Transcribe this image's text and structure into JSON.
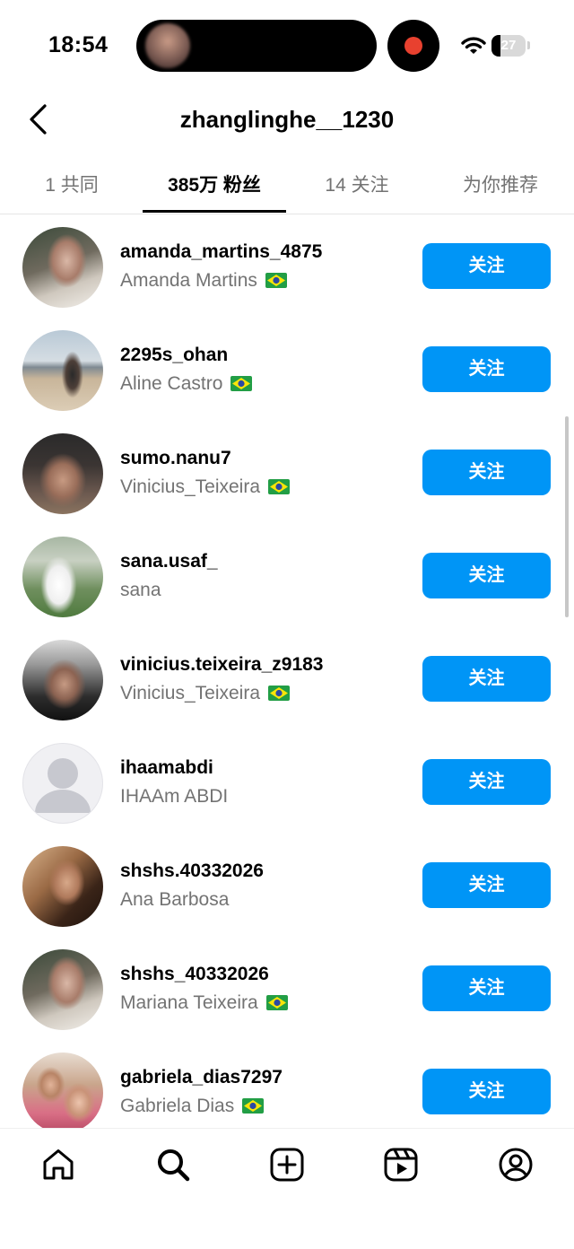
{
  "status_bar": {
    "time": "18:54",
    "battery": "27",
    "record_color": "#e8412f"
  },
  "header": {
    "title": "zhanglinghe__1230",
    "back_icon": "chevron-left-icon"
  },
  "tabs": [
    {
      "label": "1 共同",
      "active": false
    },
    {
      "label": "385万 粉丝",
      "active": true
    },
    {
      "label": "14 关注",
      "active": false
    },
    {
      "label": "为你推荐",
      "active": false
    }
  ],
  "follow_label": "关注",
  "accent_color": "#0095f6",
  "followers": [
    {
      "username": "amanda_martins_4875",
      "name": "Amanda Martins",
      "flag": "brazil-flag-icon"
    },
    {
      "username": "2295s_ohan",
      "name": "Aline Castro",
      "flag": "brazil-flag-icon"
    },
    {
      "username": "sumo.nanu7",
      "name": "Vinicius_Teixeira",
      "flag": "brazil-flag-icon"
    },
    {
      "username": "sana.usaf_",
      "name": "sana",
      "flag": null
    },
    {
      "username": "vinicius.teixeira_z9183",
      "name": "Vinicius_Teixeira",
      "flag": "brazil-flag-icon"
    },
    {
      "username": "ihaamabdi",
      "name": "IHAAm ABDI",
      "flag": null
    },
    {
      "username": "shshs.40332026",
      "name": "Ana Barbosa",
      "flag": null
    },
    {
      "username": "shshs_40332026",
      "name": "Mariana Teixeira",
      "flag": "brazil-flag-icon"
    },
    {
      "username": "gabriela_dias7297",
      "name": "Gabriela Dias",
      "flag": "brazil-flag-icon"
    }
  ],
  "bottom_nav": [
    "home-icon",
    "search-icon",
    "create-icon",
    "reels-icon",
    "profile-icon"
  ]
}
